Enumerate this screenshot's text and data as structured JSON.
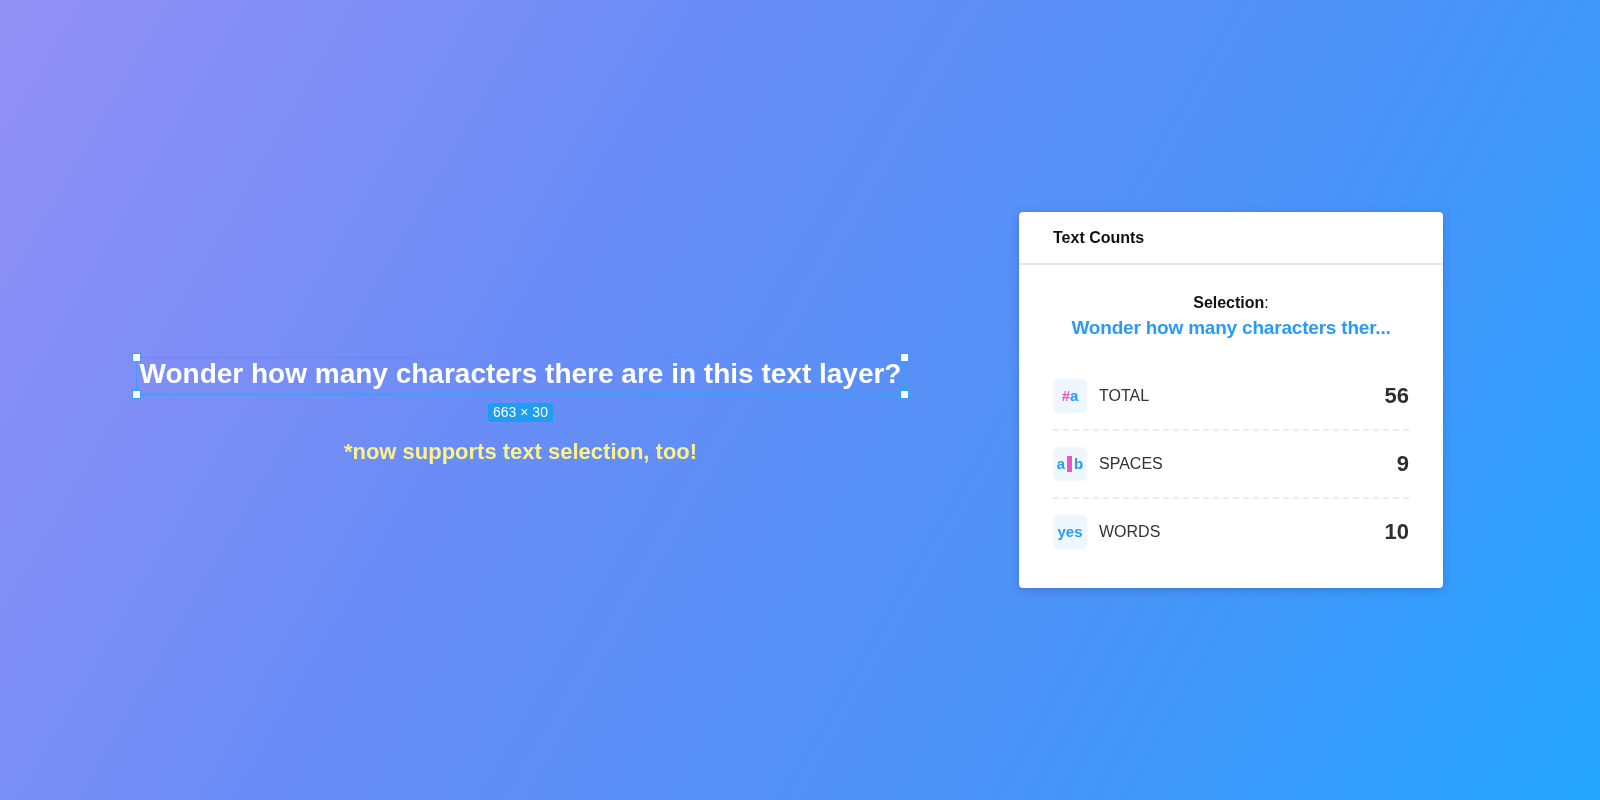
{
  "canvas": {
    "text_layer": {
      "text": "Wonder how many characters there are in this text layer?",
      "selected": true,
      "size_badge": "663 × 30"
    },
    "note": "*now supports text selection, too!"
  },
  "panel": {
    "title": "Text Counts",
    "selection_label": "**Selection**:",
    "selection_text": "Wonder how many characters ther...",
    "stats": [
      {
        "icon": [
          {
            "kind": "glyph",
            "text": "#",
            "color": "#f052c8"
          },
          {
            "kind": "glyph",
            "text": "a",
            "color": "#2a9bf0"
          }
        ],
        "label": "TOTAL",
        "value": "56"
      },
      {
        "icon": [
          {
            "kind": "glyph",
            "text": "a",
            "color": "#2a9bf0"
          },
          {
            "kind": "bar",
            "color": "#f052c8"
          },
          {
            "kind": "glyph",
            "text": "b",
            "color": "#2a9bf0"
          }
        ],
        "label": "SPACES",
        "value": "9"
      },
      {
        "icon": [
          {
            "kind": "glyph",
            "text": "yes",
            "color": "#2a9bf0"
          }
        ],
        "label": "WORDS",
        "value": "10"
      }
    ]
  }
}
